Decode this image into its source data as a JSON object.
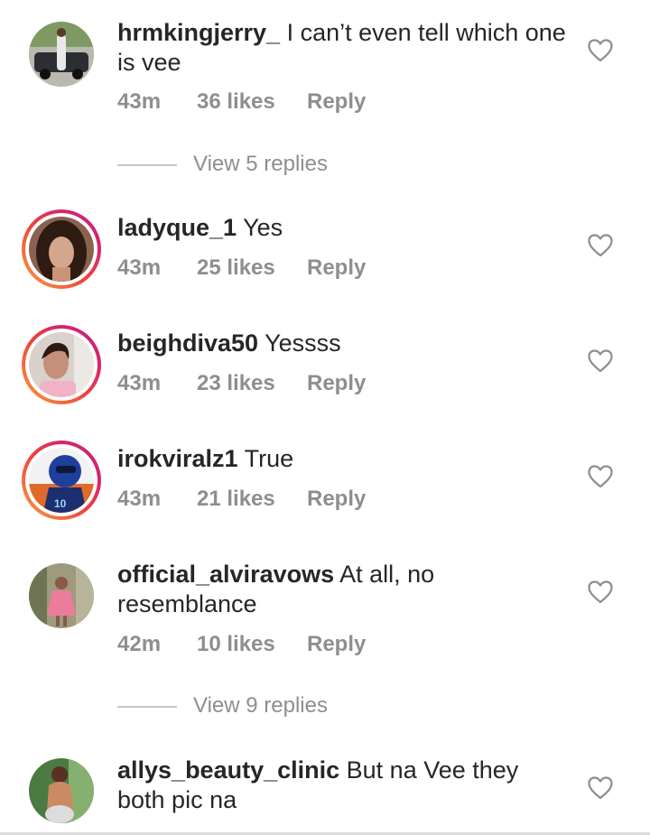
{
  "comments": [
    {
      "username": "hrmkingjerry_",
      "text": "I can’t even tell which one is vee",
      "time": "43m",
      "likes": "36 likes",
      "reply": "Reply",
      "story_ring": false,
      "avatar_colors": [
        "#6f8a55",
        "#2b2e33",
        "#d9d9d9"
      ],
      "view_replies": "View 5 replies"
    },
    {
      "username": "ladyque_1",
      "text": "Yes",
      "time": "43m",
      "likes": "25 likes",
      "reply": "Reply",
      "story_ring": true,
      "avatar_colors": [
        "#3a2418",
        "#c89a80",
        "#7a4a35"
      ]
    },
    {
      "username": "beighdiva50",
      "text": "Yessss",
      "time": "43m",
      "likes": "23 likes",
      "reply": "Reply",
      "story_ring": true,
      "avatar_colors": [
        "#d8cfc8",
        "#c99580",
        "#f0b3c4"
      ]
    },
    {
      "username": "irokviralz1",
      "text": "True",
      "time": "43m",
      "likes": "21 likes",
      "reply": "Reply",
      "story_ring": true,
      "avatar_colors": [
        "#f2f2f2",
        "#2147a8",
        "#e06a2c"
      ]
    },
    {
      "username": "official_alviravows",
      "text": "At all, no resemblance",
      "time": "42m",
      "likes": "10 likes",
      "reply": "Reply",
      "story_ring": false,
      "avatar_colors": [
        "#9a9a7a",
        "#e87a9a",
        "#5a6a4a"
      ],
      "view_replies": "View 9 replies"
    },
    {
      "username": "allys_beauty_clinic",
      "text": "But na Vee they both pic na",
      "time": "",
      "likes": "",
      "reply": "",
      "story_ring": false,
      "avatar_colors": [
        "#3f6b3a",
        "#c98a64",
        "#7fa86a"
      ]
    }
  ],
  "icons": {
    "heart": "heart-outline-icon"
  },
  "colors": {
    "text": "#262626",
    "muted": "#8e8e8e",
    "story_ring_start": "#f9a03f",
    "story_ring_end": "#c1257f"
  }
}
